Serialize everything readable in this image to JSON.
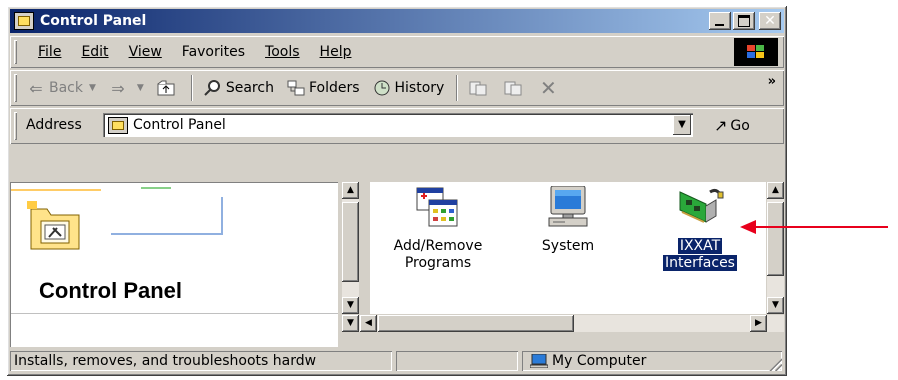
{
  "window": {
    "title": "Control Panel"
  },
  "title_buttons": {
    "minimize": "_",
    "maximize": "□",
    "close": "✕"
  },
  "menu": [
    {
      "label": "File",
      "accel": "F"
    },
    {
      "label": "Edit",
      "accel": "E"
    },
    {
      "label": "View",
      "accel": "V"
    },
    {
      "label": "Favorites",
      "accel": "a"
    },
    {
      "label": "Tools",
      "accel": "T"
    },
    {
      "label": "Help",
      "accel": "H"
    }
  ],
  "toolbar": {
    "back": "Back",
    "search": "Search",
    "folders": "Folders",
    "history": "History",
    "chevron": "»"
  },
  "address": {
    "label": "Address",
    "value": "Control Panel",
    "go": "Go"
  },
  "left_pane": {
    "heading": "Control Panel"
  },
  "items": [
    {
      "label_line1": "Add/Remove",
      "label_line2": "Programs",
      "icon": "add-remove-programs-icon",
      "selected": false
    },
    {
      "label_line1": "System",
      "label_line2": "",
      "icon": "system-icon",
      "selected": false
    },
    {
      "label_line1": "IXXAT",
      "label_line2": "Interfaces",
      "icon": "ixxat-interfaces-icon",
      "selected": true
    }
  ],
  "status": {
    "description": "Installs, removes, and troubleshoots hardw",
    "zone": "My Computer"
  },
  "colors": {
    "titlebar_start": "#0a246a",
    "titlebar_end": "#a6caf0",
    "annotation_arrow": "#e8001c"
  }
}
